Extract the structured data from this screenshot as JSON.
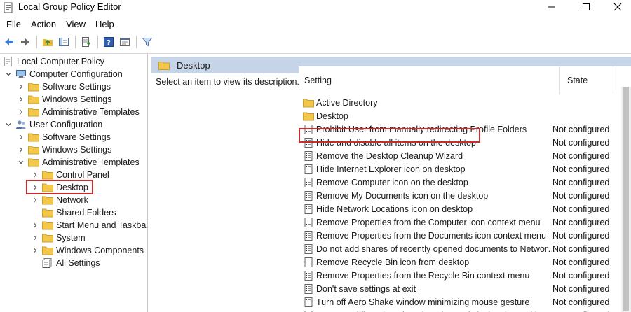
{
  "window": {
    "title": "Local Group Policy Editor"
  },
  "menu": [
    "File",
    "Action",
    "View",
    "Help"
  ],
  "tree": [
    {
      "label": "Local Computer Policy",
      "level": 0,
      "icon": "policy-icon",
      "chevron": "none"
    },
    {
      "label": "Computer Configuration",
      "level": 1,
      "icon": "computer-icon",
      "chevron": "down"
    },
    {
      "label": "Software Settings",
      "level": 2,
      "icon": "folder-icon",
      "chevron": "right"
    },
    {
      "label": "Windows Settings",
      "level": 2,
      "icon": "folder-icon",
      "chevron": "right"
    },
    {
      "label": "Administrative Templates",
      "level": 2,
      "icon": "folder-icon",
      "chevron": "right"
    },
    {
      "label": "User Configuration",
      "level": 1,
      "icon": "user-icon",
      "chevron": "down"
    },
    {
      "label": "Software Settings",
      "level": 2,
      "icon": "folder-icon",
      "chevron": "right"
    },
    {
      "label": "Windows Settings",
      "level": 2,
      "icon": "folder-icon",
      "chevron": "right"
    },
    {
      "label": "Administrative Templates",
      "level": 2,
      "icon": "folder-icon",
      "chevron": "down"
    },
    {
      "label": "Control Panel",
      "level": 3,
      "icon": "folder-icon",
      "chevron": "right"
    },
    {
      "label": "Desktop",
      "level": 3,
      "icon": "folder-icon",
      "chevron": "right",
      "selected": true
    },
    {
      "label": "Network",
      "level": 3,
      "icon": "folder-icon",
      "chevron": "right"
    },
    {
      "label": "Shared Folders",
      "level": 3,
      "icon": "folder-icon",
      "chevron": "none"
    },
    {
      "label": "Start Menu and Taskbar",
      "level": 3,
      "icon": "folder-icon",
      "chevron": "right"
    },
    {
      "label": "System",
      "level": 3,
      "icon": "folder-icon",
      "chevron": "right"
    },
    {
      "label": "Windows Components",
      "level": 3,
      "icon": "folder-icon",
      "chevron": "right"
    },
    {
      "label": "All Settings",
      "level": 3,
      "icon": "all-settings-icon",
      "chevron": "none"
    }
  ],
  "right_pane": {
    "header": "Desktop",
    "description": "Select an item to view its description.",
    "columns": {
      "setting": "Setting",
      "state": "State"
    },
    "rows": [
      {
        "name": "Active Directory",
        "state": "",
        "icon": "folder-icon"
      },
      {
        "name": "Desktop",
        "state": "",
        "icon": "folder-icon"
      },
      {
        "name": "Prohibit User from manually redirecting Profile Folders",
        "state": "Not configured",
        "icon": "setting-icon"
      },
      {
        "name": "Hide and disable all items on the desktop",
        "state": "Not configured",
        "icon": "setting-icon",
        "highlighted": true
      },
      {
        "name": "Remove the Desktop Cleanup Wizard",
        "state": "Not configured",
        "icon": "setting-icon"
      },
      {
        "name": "Hide Internet Explorer icon on desktop",
        "state": "Not configured",
        "icon": "setting-icon"
      },
      {
        "name": "Remove Computer icon on the desktop",
        "state": "Not configured",
        "icon": "setting-icon"
      },
      {
        "name": "Remove My Documents icon on the desktop",
        "state": "Not configured",
        "icon": "setting-icon"
      },
      {
        "name": "Hide Network Locations icon on desktop",
        "state": "Not configured",
        "icon": "setting-icon"
      },
      {
        "name": "Remove Properties from the Computer icon context menu",
        "state": "Not configured",
        "icon": "setting-icon"
      },
      {
        "name": "Remove Properties from the Documents icon context menu",
        "state": "Not configured",
        "icon": "setting-icon"
      },
      {
        "name": "Do not add shares of recently opened documents to Network Locations",
        "state": "Not configured",
        "icon": "setting-icon"
      },
      {
        "name": "Remove Recycle Bin icon from desktop",
        "state": "Not configured",
        "icon": "setting-icon"
      },
      {
        "name": "Remove Properties from the Recycle Bin context menu",
        "state": "Not configured",
        "icon": "setting-icon"
      },
      {
        "name": "Don't save settings at exit",
        "state": "Not configured",
        "icon": "setting-icon"
      },
      {
        "name": "Turn off Aero Shake window minimizing mouse gesture",
        "state": "Not configured",
        "icon": "setting-icon"
      },
      {
        "name": "Prevent adding, dragging, dropping and closing the Taskbar's toolbars",
        "state": "Not configured",
        "icon": "setting-icon"
      }
    ]
  },
  "colors": {
    "header_bg": "#c6d4e8",
    "highlight_border": "#c72d2d",
    "folder": "#f3c74a"
  }
}
